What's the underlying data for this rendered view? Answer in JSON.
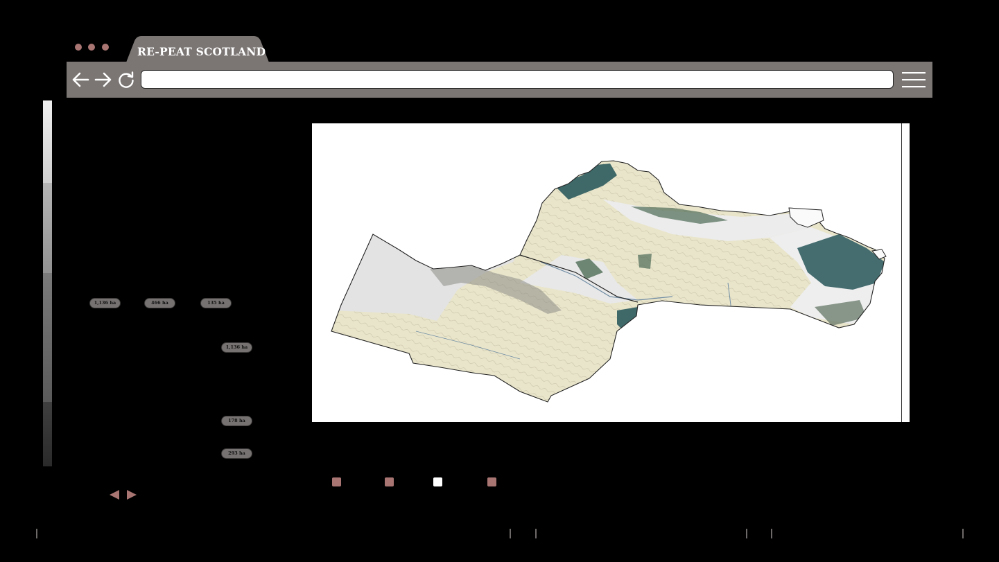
{
  "browser": {
    "tab_title": "RE-PEAT SCOTLAND",
    "url": "",
    "icons": [
      "back-arrow-icon",
      "forward-arrow-icon",
      "reload-icon",
      "hamburger-menu-icon"
    ],
    "window_dots_color": "#a87573",
    "chrome_color": "#7b7674"
  },
  "area_labels": {
    "row_top": [
      "1,136 ha",
      "466 ha",
      "135 ha"
    ],
    "right_1": "1,136 ha",
    "right_2": "178 ha",
    "right_3": "293 ha"
  },
  "map": {
    "colors": {
      "peat": "#e6e2c6",
      "forest": "#3f6868",
      "snow_rock": "#e6e6e6",
      "contour": "#b8b49b",
      "river": "#6f8ca3"
    }
  },
  "legend_colors": [
    "#a87573",
    "#a87573",
    "#ffffff",
    "#a87573"
  ],
  "pager": {
    "icons": [
      "prev-triangle-icon",
      "next-triangle-icon"
    ],
    "color": "#a87573"
  }
}
